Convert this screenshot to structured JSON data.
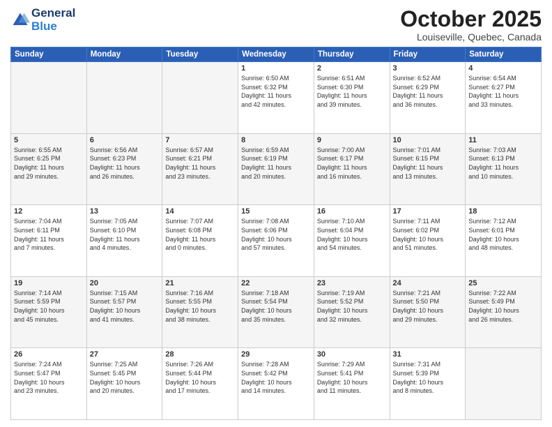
{
  "header": {
    "logo_line1": "General",
    "logo_line2": "Blue",
    "month_title": "October 2025",
    "location": "Louiseville, Quebec, Canada"
  },
  "days_of_week": [
    "Sunday",
    "Monday",
    "Tuesday",
    "Wednesday",
    "Thursday",
    "Friday",
    "Saturday"
  ],
  "weeks": [
    [
      {
        "day": "",
        "info": ""
      },
      {
        "day": "",
        "info": ""
      },
      {
        "day": "",
        "info": ""
      },
      {
        "day": "1",
        "info": "Sunrise: 6:50 AM\nSunset: 6:32 PM\nDaylight: 11 hours\nand 42 minutes."
      },
      {
        "day": "2",
        "info": "Sunrise: 6:51 AM\nSunset: 6:30 PM\nDaylight: 11 hours\nand 39 minutes."
      },
      {
        "day": "3",
        "info": "Sunrise: 6:52 AM\nSunset: 6:29 PM\nDaylight: 11 hours\nand 36 minutes."
      },
      {
        "day": "4",
        "info": "Sunrise: 6:54 AM\nSunset: 6:27 PM\nDaylight: 11 hours\nand 33 minutes."
      }
    ],
    [
      {
        "day": "5",
        "info": "Sunrise: 6:55 AM\nSunset: 6:25 PM\nDaylight: 11 hours\nand 29 minutes."
      },
      {
        "day": "6",
        "info": "Sunrise: 6:56 AM\nSunset: 6:23 PM\nDaylight: 11 hours\nand 26 minutes."
      },
      {
        "day": "7",
        "info": "Sunrise: 6:57 AM\nSunset: 6:21 PM\nDaylight: 11 hours\nand 23 minutes."
      },
      {
        "day": "8",
        "info": "Sunrise: 6:59 AM\nSunset: 6:19 PM\nDaylight: 11 hours\nand 20 minutes."
      },
      {
        "day": "9",
        "info": "Sunrise: 7:00 AM\nSunset: 6:17 PM\nDaylight: 11 hours\nand 16 minutes."
      },
      {
        "day": "10",
        "info": "Sunrise: 7:01 AM\nSunset: 6:15 PM\nDaylight: 11 hours\nand 13 minutes."
      },
      {
        "day": "11",
        "info": "Sunrise: 7:03 AM\nSunset: 6:13 PM\nDaylight: 11 hours\nand 10 minutes."
      }
    ],
    [
      {
        "day": "12",
        "info": "Sunrise: 7:04 AM\nSunset: 6:11 PM\nDaylight: 11 hours\nand 7 minutes."
      },
      {
        "day": "13",
        "info": "Sunrise: 7:05 AM\nSunset: 6:10 PM\nDaylight: 11 hours\nand 4 minutes."
      },
      {
        "day": "14",
        "info": "Sunrise: 7:07 AM\nSunset: 6:08 PM\nDaylight: 11 hours\nand 0 minutes."
      },
      {
        "day": "15",
        "info": "Sunrise: 7:08 AM\nSunset: 6:06 PM\nDaylight: 10 hours\nand 57 minutes."
      },
      {
        "day": "16",
        "info": "Sunrise: 7:10 AM\nSunset: 6:04 PM\nDaylight: 10 hours\nand 54 minutes."
      },
      {
        "day": "17",
        "info": "Sunrise: 7:11 AM\nSunset: 6:02 PM\nDaylight: 10 hours\nand 51 minutes."
      },
      {
        "day": "18",
        "info": "Sunrise: 7:12 AM\nSunset: 6:01 PM\nDaylight: 10 hours\nand 48 minutes."
      }
    ],
    [
      {
        "day": "19",
        "info": "Sunrise: 7:14 AM\nSunset: 5:59 PM\nDaylight: 10 hours\nand 45 minutes."
      },
      {
        "day": "20",
        "info": "Sunrise: 7:15 AM\nSunset: 5:57 PM\nDaylight: 10 hours\nand 41 minutes."
      },
      {
        "day": "21",
        "info": "Sunrise: 7:16 AM\nSunset: 5:55 PM\nDaylight: 10 hours\nand 38 minutes."
      },
      {
        "day": "22",
        "info": "Sunrise: 7:18 AM\nSunset: 5:54 PM\nDaylight: 10 hours\nand 35 minutes."
      },
      {
        "day": "23",
        "info": "Sunrise: 7:19 AM\nSunset: 5:52 PM\nDaylight: 10 hours\nand 32 minutes."
      },
      {
        "day": "24",
        "info": "Sunrise: 7:21 AM\nSunset: 5:50 PM\nDaylight: 10 hours\nand 29 minutes."
      },
      {
        "day": "25",
        "info": "Sunrise: 7:22 AM\nSunset: 5:49 PM\nDaylight: 10 hours\nand 26 minutes."
      }
    ],
    [
      {
        "day": "26",
        "info": "Sunrise: 7:24 AM\nSunset: 5:47 PM\nDaylight: 10 hours\nand 23 minutes."
      },
      {
        "day": "27",
        "info": "Sunrise: 7:25 AM\nSunset: 5:45 PM\nDaylight: 10 hours\nand 20 minutes."
      },
      {
        "day": "28",
        "info": "Sunrise: 7:26 AM\nSunset: 5:44 PM\nDaylight: 10 hours\nand 17 minutes."
      },
      {
        "day": "29",
        "info": "Sunrise: 7:28 AM\nSunset: 5:42 PM\nDaylight: 10 hours\nand 14 minutes."
      },
      {
        "day": "30",
        "info": "Sunrise: 7:29 AM\nSunset: 5:41 PM\nDaylight: 10 hours\nand 11 minutes."
      },
      {
        "day": "31",
        "info": "Sunrise: 7:31 AM\nSunset: 5:39 PM\nDaylight: 10 hours\nand 8 minutes."
      },
      {
        "day": "",
        "info": ""
      }
    ]
  ]
}
